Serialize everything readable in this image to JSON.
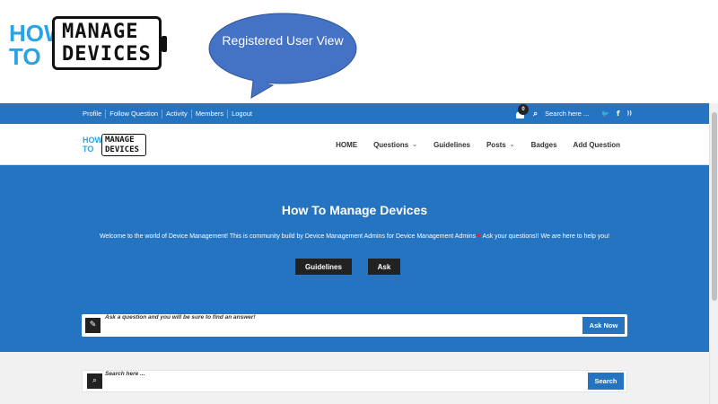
{
  "logo": {
    "how": "HOW",
    "to": "TO",
    "line1": "MANAGE",
    "line2": "DEVICES"
  },
  "callout": {
    "text": "Registered User View",
    "color": "#4472c4"
  },
  "topbar": {
    "links": [
      "Profile",
      "Follow Question",
      "Activity",
      "Members",
      "Logout"
    ],
    "notification_count": "0",
    "search_placeholder": "Search here ...",
    "twitter": "🐦",
    "facebook": "f",
    "rss": "))"
  },
  "nav": {
    "items": [
      {
        "label": "HOME",
        "dropdown": false
      },
      {
        "label": "Questions",
        "dropdown": true
      },
      {
        "label": "Guidelines",
        "dropdown": false
      },
      {
        "label": "Posts",
        "dropdown": true
      },
      {
        "label": "Badges",
        "dropdown": false
      },
      {
        "label": "Add Question",
        "dropdown": false
      }
    ]
  },
  "hero": {
    "title": "How To Manage Devices",
    "subtitle_a": "Welcome to the world of Device Management! This is community build by Device Management Admins for Device Management Admins",
    "subtitle_b": " Ask your questions!! We are here to help you!",
    "btn_guidelines": "Guidelines",
    "btn_ask": "Ask"
  },
  "ask": {
    "placeholder": "Ask a question and you will be sure to find an answer!",
    "button": "Ask Now"
  },
  "search": {
    "placeholder": "Search here ...",
    "button": "Search"
  },
  "colors": {
    "brand_blue": "#2474c1",
    "logo_blue": "#2aa3e4",
    "dark": "#222222"
  }
}
